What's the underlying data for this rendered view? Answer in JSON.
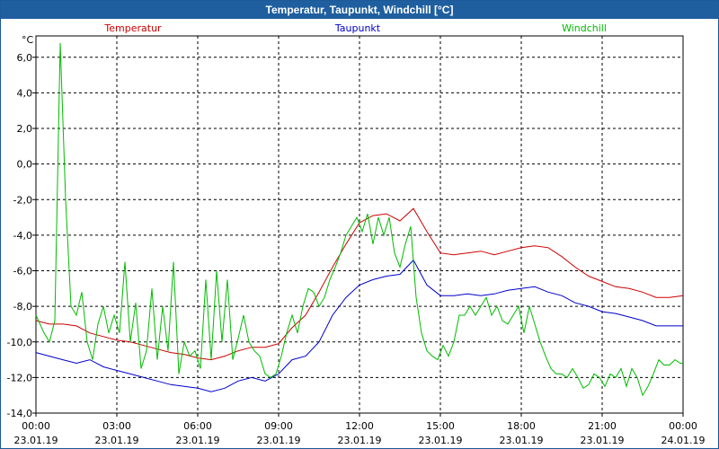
{
  "window": {
    "title": "Temperatur, Taupunkt, Windchill [°C]"
  },
  "chart_data": {
    "type": "line",
    "title": "Temperatur, Taupunkt, Windchill [°C]",
    "ylabel": "°C",
    "xlabel": "",
    "ylim": [
      -14,
      7.2
    ],
    "xlim": [
      0,
      24
    ],
    "grid": true,
    "legend_position": "top",
    "yticks": [
      "6,0",
      "4,0",
      "2,0",
      "0,0",
      "-2,0",
      "-4,0",
      "-6,0",
      "-8,0",
      "-10,0",
      "-12,0",
      "-14,0"
    ],
    "ytick_values": [
      6,
      4,
      2,
      0,
      -2,
      -4,
      -6,
      -8,
      -10,
      -12,
      -14
    ],
    "xticks": [
      {
        "time": "00:00",
        "date": "23.01.19",
        "h": 0
      },
      {
        "time": "03:00",
        "date": "23.01.19",
        "h": 3
      },
      {
        "time": "06:00",
        "date": "23.01.19",
        "h": 6
      },
      {
        "time": "09:00",
        "date": "23.01.19",
        "h": 9
      },
      {
        "time": "12:00",
        "date": "23.01.19",
        "h": 12
      },
      {
        "time": "15:00",
        "date": "23.01.19",
        "h": 15
      },
      {
        "time": "18:00",
        "date": "23.01.19",
        "h": 18
      },
      {
        "time": "21:00",
        "date": "23.01.19",
        "h": 21
      },
      {
        "time": "00:00",
        "date": "24.01.19",
        "h": 24
      }
    ],
    "series": [
      {
        "name": "Temperatur",
        "color": "#cc0000",
        "points": [
          [
            0,
            -8.8
          ],
          [
            0.5,
            -9.0
          ],
          [
            1.0,
            -9.0
          ],
          [
            1.5,
            -9.1
          ],
          [
            2.0,
            -9.5
          ],
          [
            2.5,
            -9.7
          ],
          [
            3.0,
            -9.9
          ],
          [
            3.5,
            -10.0
          ],
          [
            4.0,
            -10.2
          ],
          [
            4.5,
            -10.4
          ],
          [
            5.0,
            -10.6
          ],
          [
            5.5,
            -10.7
          ],
          [
            6.0,
            -10.9
          ],
          [
            6.5,
            -11.0
          ],
          [
            7.0,
            -10.8
          ],
          [
            7.5,
            -10.5
          ],
          [
            8.0,
            -10.3
          ],
          [
            8.5,
            -10.3
          ],
          [
            9.0,
            -10.1
          ],
          [
            9.5,
            -9.2
          ],
          [
            10.0,
            -8.5
          ],
          [
            10.5,
            -7.2
          ],
          [
            11.0,
            -5.8
          ],
          [
            11.5,
            -4.5
          ],
          [
            12.0,
            -3.3
          ],
          [
            12.5,
            -2.9
          ],
          [
            13.0,
            -2.8
          ],
          [
            13.5,
            -3.2
          ],
          [
            14.0,
            -2.5
          ],
          [
            14.5,
            -3.8
          ],
          [
            15.0,
            -5.0
          ],
          [
            15.5,
            -5.1
          ],
          [
            16.0,
            -5.0
          ],
          [
            16.5,
            -4.9
          ],
          [
            17.0,
            -5.1
          ],
          [
            17.5,
            -4.9
          ],
          [
            18.0,
            -4.7
          ],
          [
            18.5,
            -4.6
          ],
          [
            19.0,
            -4.7
          ],
          [
            19.5,
            -5.2
          ],
          [
            20.0,
            -5.8
          ],
          [
            20.5,
            -6.3
          ],
          [
            21.0,
            -6.6
          ],
          [
            21.5,
            -6.9
          ],
          [
            22.0,
            -7.0
          ],
          [
            22.5,
            -7.2
          ],
          [
            23.0,
            -7.5
          ],
          [
            23.5,
            -7.5
          ],
          [
            24.0,
            -7.4
          ]
        ]
      },
      {
        "name": "Taupunkt",
        "color": "#0000cc",
        "points": [
          [
            0,
            -10.6
          ],
          [
            0.5,
            -10.8
          ],
          [
            1.0,
            -11.0
          ],
          [
            1.5,
            -11.2
          ],
          [
            2.0,
            -11.0
          ],
          [
            2.5,
            -11.4
          ],
          [
            3.0,
            -11.6
          ],
          [
            3.5,
            -11.8
          ],
          [
            4.0,
            -12.0
          ],
          [
            4.5,
            -12.2
          ],
          [
            5.0,
            -12.4
          ],
          [
            5.5,
            -12.5
          ],
          [
            6.0,
            -12.6
          ],
          [
            6.5,
            -12.8
          ],
          [
            7.0,
            -12.6
          ],
          [
            7.5,
            -12.2
          ],
          [
            8.0,
            -12.0
          ],
          [
            8.5,
            -12.2
          ],
          [
            9.0,
            -11.8
          ],
          [
            9.5,
            -11.0
          ],
          [
            10.0,
            -10.8
          ],
          [
            10.5,
            -10.0
          ],
          [
            11.0,
            -8.5
          ],
          [
            11.5,
            -7.5
          ],
          [
            12.0,
            -6.8
          ],
          [
            12.5,
            -6.5
          ],
          [
            13.0,
            -6.3
          ],
          [
            13.5,
            -6.2
          ],
          [
            14.0,
            -5.4
          ],
          [
            14.5,
            -6.8
          ],
          [
            15.0,
            -7.4
          ],
          [
            15.5,
            -7.4
          ],
          [
            16.0,
            -7.3
          ],
          [
            16.5,
            -7.4
          ],
          [
            17.0,
            -7.3
          ],
          [
            17.5,
            -7.1
          ],
          [
            18.0,
            -7.0
          ],
          [
            18.5,
            -6.9
          ],
          [
            19.0,
            -7.2
          ],
          [
            19.5,
            -7.4
          ],
          [
            20.0,
            -7.8
          ],
          [
            20.5,
            -8.0
          ],
          [
            21.0,
            -8.3
          ],
          [
            21.5,
            -8.4
          ],
          [
            22.0,
            -8.6
          ],
          [
            22.5,
            -8.8
          ],
          [
            23.0,
            -9.1
          ],
          [
            23.5,
            -9.1
          ],
          [
            24.0,
            -9.1
          ]
        ]
      },
      {
        "name": "Windchill",
        "color": "#00bb00",
        "points": [
          [
            0,
            -8.5
          ],
          [
            0.3,
            -9.5
          ],
          [
            0.5,
            -10.0
          ],
          [
            0.7,
            -8.8
          ],
          [
            0.9,
            6.8
          ],
          [
            1.1,
            -2.0
          ],
          [
            1.3,
            -8.0
          ],
          [
            1.5,
            -8.5
          ],
          [
            1.7,
            -7.2
          ],
          [
            1.9,
            -10.0
          ],
          [
            2.1,
            -11.0
          ],
          [
            2.3,
            -9.0
          ],
          [
            2.5,
            -8.0
          ],
          [
            2.7,
            -9.5
          ],
          [
            2.9,
            -8.5
          ],
          [
            3.1,
            -9.5
          ],
          [
            3.3,
            -5.5
          ],
          [
            3.5,
            -10.0
          ],
          [
            3.7,
            -7.8
          ],
          [
            3.9,
            -11.5
          ],
          [
            4.1,
            -10.5
          ],
          [
            4.3,
            -7.0
          ],
          [
            4.5,
            -11.0
          ],
          [
            4.7,
            -8.0
          ],
          [
            4.9,
            -10.5
          ],
          [
            5.1,
            -5.5
          ],
          [
            5.3,
            -11.8
          ],
          [
            5.5,
            -10.0
          ],
          [
            5.7,
            -10.8
          ],
          [
            5.9,
            -10.5
          ],
          [
            6.1,
            -11.5
          ],
          [
            6.3,
            -6.5
          ],
          [
            6.5,
            -11.0
          ],
          [
            6.7,
            -6.0
          ],
          [
            6.9,
            -10.0
          ],
          [
            7.1,
            -6.5
          ],
          [
            7.3,
            -11.0
          ],
          [
            7.5,
            -9.8
          ],
          [
            7.7,
            -8.5
          ],
          [
            7.9,
            -10.0
          ],
          [
            8.1,
            -10.5
          ],
          [
            8.3,
            -10.8
          ],
          [
            8.5,
            -11.8
          ],
          [
            8.7,
            -12.0
          ],
          [
            8.9,
            -11.8
          ],
          [
            9.1,
            -10.8
          ],
          [
            9.3,
            -9.5
          ],
          [
            9.5,
            -8.5
          ],
          [
            9.7,
            -9.5
          ],
          [
            9.9,
            -8.0
          ],
          [
            10.1,
            -7.0
          ],
          [
            10.3,
            -7.2
          ],
          [
            10.5,
            -8.0
          ],
          [
            10.7,
            -7.5
          ],
          [
            10.9,
            -6.5
          ],
          [
            11.1,
            -5.8
          ],
          [
            11.3,
            -5.0
          ],
          [
            11.5,
            -4.0
          ],
          [
            11.7,
            -3.5
          ],
          [
            11.9,
            -3.0
          ],
          [
            12.1,
            -3.8
          ],
          [
            12.3,
            -2.8
          ],
          [
            12.5,
            -4.5
          ],
          [
            12.7,
            -3.0
          ],
          [
            12.9,
            -4.0
          ],
          [
            13.1,
            -3.0
          ],
          [
            13.3,
            -5.0
          ],
          [
            13.5,
            -5.8
          ],
          [
            13.7,
            -4.5
          ],
          [
            13.9,
            -3.5
          ],
          [
            14.1,
            -7.5
          ],
          [
            14.3,
            -9.5
          ],
          [
            14.5,
            -10.5
          ],
          [
            14.7,
            -10.8
          ],
          [
            14.9,
            -11.0
          ],
          [
            15.1,
            -10.2
          ],
          [
            15.3,
            -10.8
          ],
          [
            15.5,
            -10.0
          ],
          [
            15.7,
            -8.5
          ],
          [
            15.9,
            -8.5
          ],
          [
            16.1,
            -8.0
          ],
          [
            16.3,
            -8.5
          ],
          [
            16.5,
            -8.0
          ],
          [
            16.7,
            -7.5
          ],
          [
            16.9,
            -8.5
          ],
          [
            17.1,
            -8.0
          ],
          [
            17.3,
            -8.8
          ],
          [
            17.5,
            -9.0
          ],
          [
            17.7,
            -8.5
          ],
          [
            17.9,
            -8.0
          ],
          [
            18.1,
            -9.5
          ],
          [
            18.3,
            -8.0
          ],
          [
            18.5,
            -9.0
          ],
          [
            18.7,
            -10.0
          ],
          [
            18.9,
            -10.8
          ],
          [
            19.1,
            -11.5
          ],
          [
            19.3,
            -11.8
          ],
          [
            19.5,
            -11.8
          ],
          [
            19.7,
            -12.0
          ],
          [
            19.9,
            -11.5
          ],
          [
            20.1,
            -12.0
          ],
          [
            20.3,
            -12.6
          ],
          [
            20.5,
            -12.4
          ],
          [
            20.7,
            -11.8
          ],
          [
            20.9,
            -12.0
          ],
          [
            21.1,
            -12.5
          ],
          [
            21.3,
            -11.8
          ],
          [
            21.5,
            -12.0
          ],
          [
            21.7,
            -11.5
          ],
          [
            21.9,
            -12.5
          ],
          [
            22.1,
            -11.5
          ],
          [
            22.3,
            -12.0
          ],
          [
            22.5,
            -13.0
          ],
          [
            22.7,
            -12.5
          ],
          [
            22.9,
            -11.8
          ],
          [
            23.1,
            -11.0
          ],
          [
            23.3,
            -11.3
          ],
          [
            23.5,
            -11.3
          ],
          [
            23.7,
            -11.0
          ],
          [
            23.9,
            -11.2
          ],
          [
            24.0,
            -11.2
          ]
        ]
      }
    ]
  }
}
